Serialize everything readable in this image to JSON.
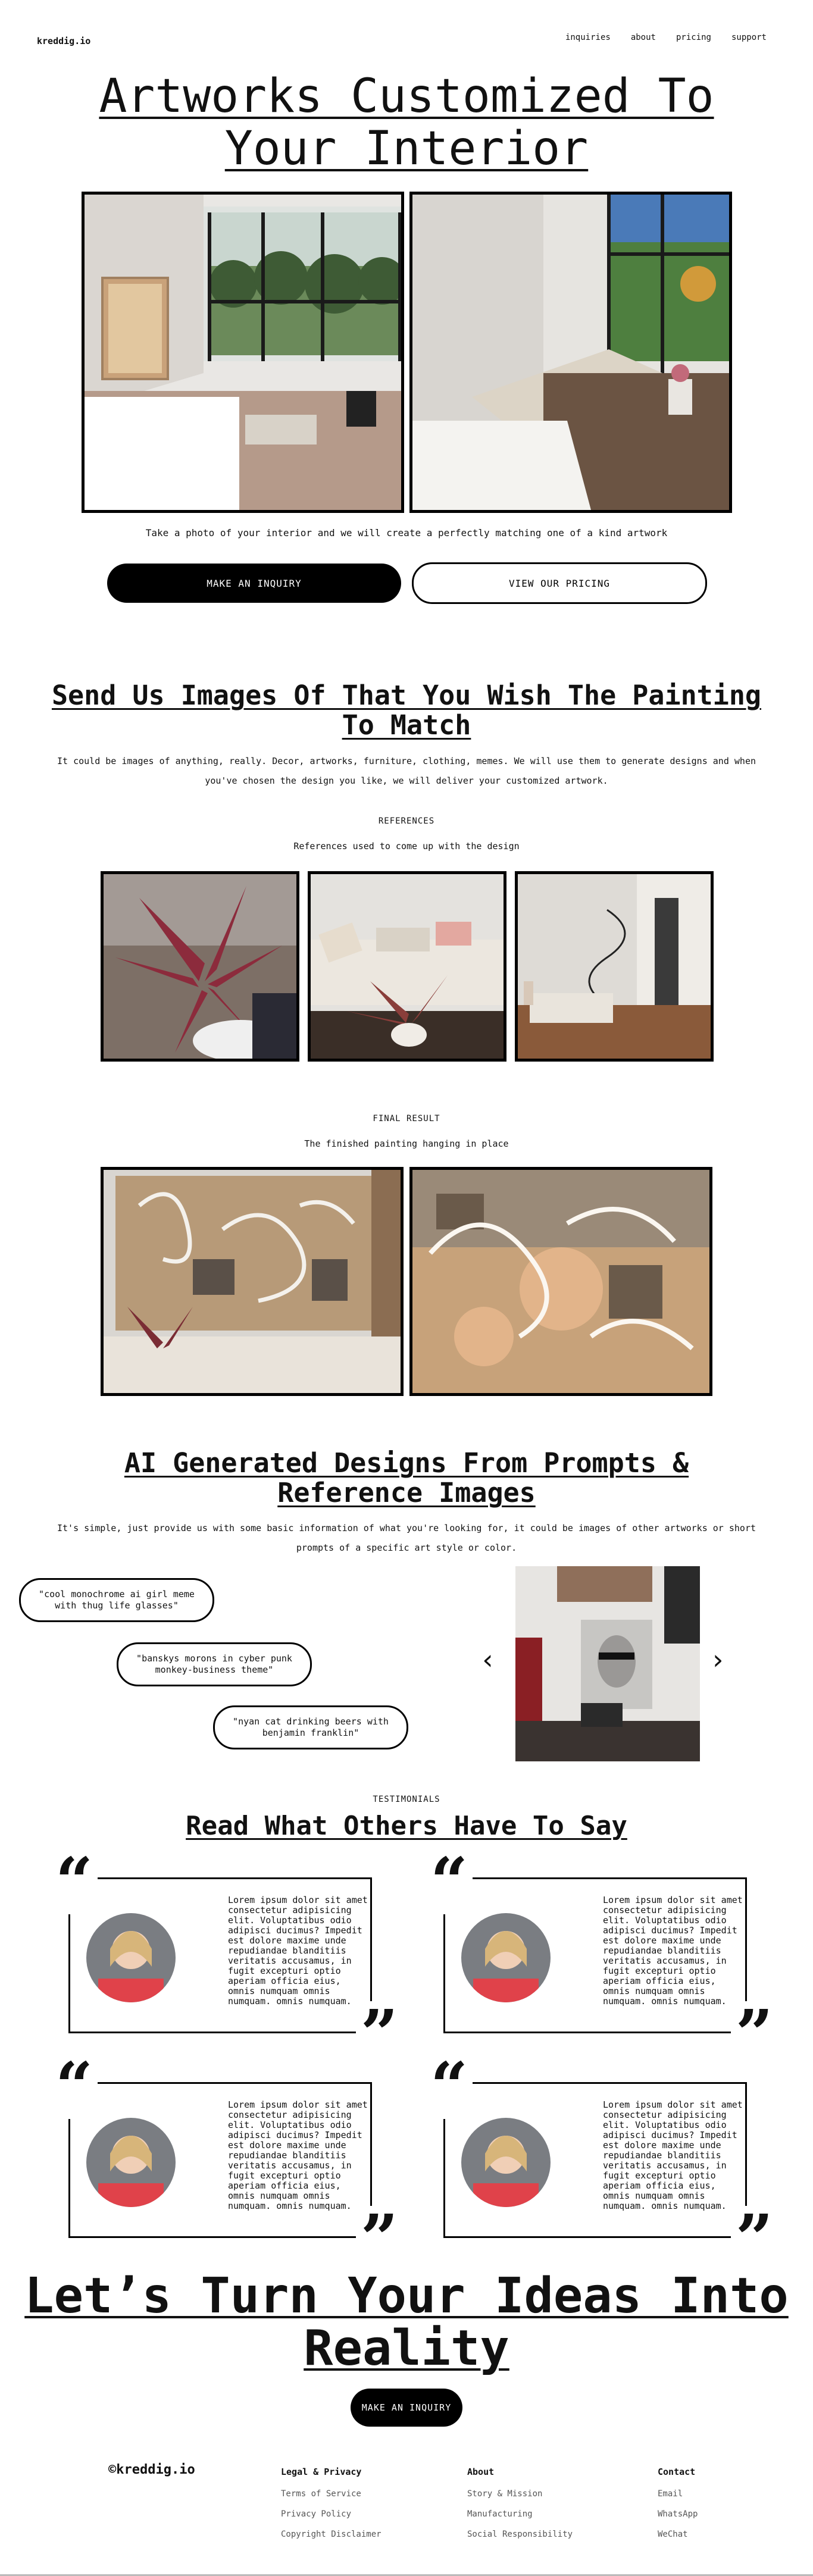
{
  "nav": {
    "brand": "kreddig.io",
    "links": [
      "inquiries",
      "about",
      "pricing",
      "support"
    ]
  },
  "hero": {
    "title_line1": "Artworks Customized To",
    "title_line2": "Your Interior",
    "tagline": "Take a photo of your interior and we will create a perfectly matching one of a kind artwork",
    "primary_button": "MAKE AN INQUIRY",
    "secondary_button": "VIEW OUR PRICING"
  },
  "match": {
    "title_line1": "Send Us Images Of That You Wish The Painting",
    "title_line2": "To Match",
    "text_line1": "It could be images of anything, really. Decor, artworks, furniture, clothing, memes. We will use them to generate designs and when",
    "text_line2": "you've chosen the design you like, we will deliver your customized artwork.",
    "references_label": "REFERENCES",
    "references_caption": "References used to come up with the design",
    "result_label": "FINAL RESULT",
    "result_caption": "The finished painting hanging in place"
  },
  "ai": {
    "title_line1": "AI Generated Designs From Prompts &",
    "title_line2": "Reference Images",
    "text_line1": "It's simple, just provide us with some basic information of what you're looking for, it could be images of other artworks or short",
    "text_line2": "prompts of a specific art style or color.",
    "prompts": [
      {
        "line1": "\"cool monochrome ai girl meme",
        "line2": "with thug life glasses\""
      },
      {
        "line1": "\"banskys morons in cyber punk",
        "line2": "monkey-business theme\""
      },
      {
        "line1": "\"nyan cat drinking beers with",
        "line2": "benjamin franklin\""
      }
    ],
    "prev_arrow": "‹",
    "next_arrow": "›"
  },
  "testimonials": {
    "label": "TESTIMONIALS",
    "title": "Read What Others Have To Say",
    "items": [
      {
        "text": "Lorem ipsum dolor sit amet consectetur adipisicing elit. Voluptatibus odio adipisci ducimus? Impedit est dolore maxime unde repudiandae blanditiis veritatis accusamus, in fugit excepturi optio aperiam officia eius, omnis numquam omnis numquam. omnis numquam."
      },
      {
        "text": "Lorem ipsum dolor sit amet consectetur adipisicing elit. Voluptatibus odio adipisci ducimus? Impedit est dolore maxime unde repudiandae blanditiis veritatis accusamus, in fugit excepturi optio aperiam officia eius, omnis numquam omnis numquam. omnis numquam."
      },
      {
        "text": "Lorem ipsum dolor sit amet consectetur adipisicing elit. Voluptatibus odio adipisci ducimus? Impedit est dolore maxime unde repudiandae blanditiis veritatis accusamus, in fugit excepturi optio aperiam officia eius, omnis numquam omnis numquam. omnis numquam."
      },
      {
        "text": "Lorem ipsum dolor sit amet consectetur adipisicing elit. Voluptatibus odio adipisci ducimus? Impedit est dolore maxime unde repudiandae blanditiis veritatis accusamus, in fugit excepturi optio aperiam officia eius, omnis numquam omnis numquam. omnis numquam."
      }
    ]
  },
  "cta": {
    "title_line1": "Let’s Turn Your Ideas Into",
    "title_line2": "Reality",
    "button": "MAKE AN INQUIRY"
  },
  "footer": {
    "copyright": "©kreddig.io",
    "legal": {
      "heading": "Legal & Privacy",
      "links": [
        "Terms of Service",
        "Privacy Policy",
        "Copyright Disclaimer"
      ]
    },
    "about": {
      "heading": "About",
      "links": [
        "Story & Mission",
        "Manufacturing",
        "Social Responsibility"
      ]
    },
    "contact": {
      "heading": "Contact",
      "links": [
        "Email",
        "WhatsApp",
        "WeChat"
      ]
    }
  }
}
